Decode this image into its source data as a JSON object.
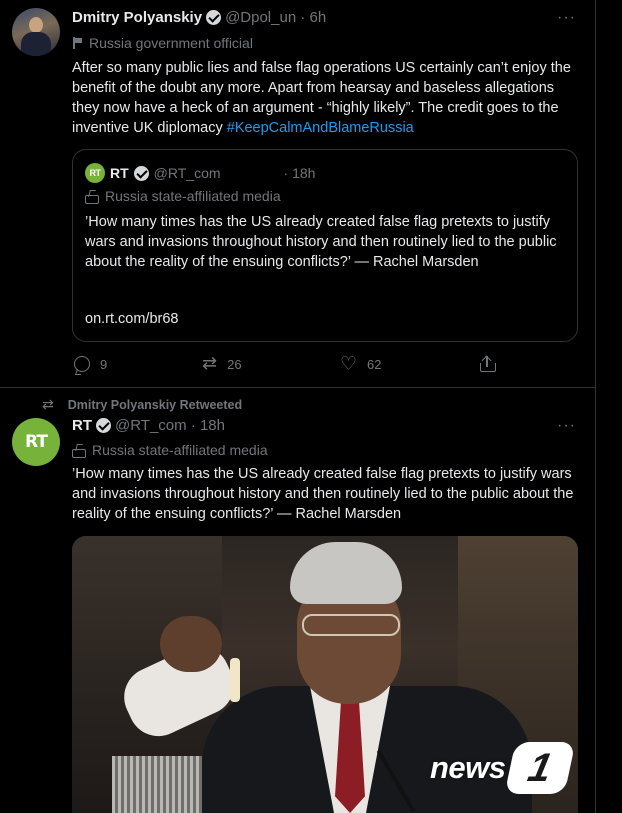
{
  "tweet1": {
    "author_name": "Dmitry Polyanskiy",
    "handle_time": "@Dpol_un · 6h",
    "label": "Russia government official",
    "text": "After so many public lies and false flag operations US certainly can’t enjoy the benefit of the doubt any more. Apart from hearsay and baseless allegations they now have a heck of an argument - “highly likely”. The credit goes to the inventive UK diplomacy ",
    "hashtag": "#KeepCalmAndBlameRussia",
    "quote": {
      "avatar_text": "RT",
      "name": "RT",
      "handle": "@RT_com",
      "time": "· 18h",
      "label": "Russia state-affiliated media",
      "text": "’How many times has the US already created false flag pretexts to justify wars and invasions throughout history and then routinely lied to the public about the reality of the ensuing conflicts?’ — Rachel Marsden",
      "link": "on.rt.com/br68"
    },
    "stats": {
      "replies": "9",
      "retweets": "26",
      "likes": "62"
    }
  },
  "tweet2": {
    "retweeted_by": "Dmitry Polyanskiy Retweeted",
    "avatar_text": "RT",
    "author_name": "RT",
    "handle_time": "@RT_com · 18h",
    "label": "Russia state-affiliated media",
    "text": "’How many times has the US already created false flag pretexts to justify wars and invasions throughout history and then routinely lied to the public about the reality of the ensuing conflicts?’ — Rachel Marsden"
  },
  "icons": {
    "more": "···",
    "retweet_glyph": "⇄",
    "heart_glyph": "♡"
  },
  "watermark": {
    "text": "news",
    "badge": "1"
  },
  "colors": {
    "background": "#000000",
    "link": "#1d9bf0",
    "muted": "#71767b",
    "rt_green": "#77b23a"
  }
}
